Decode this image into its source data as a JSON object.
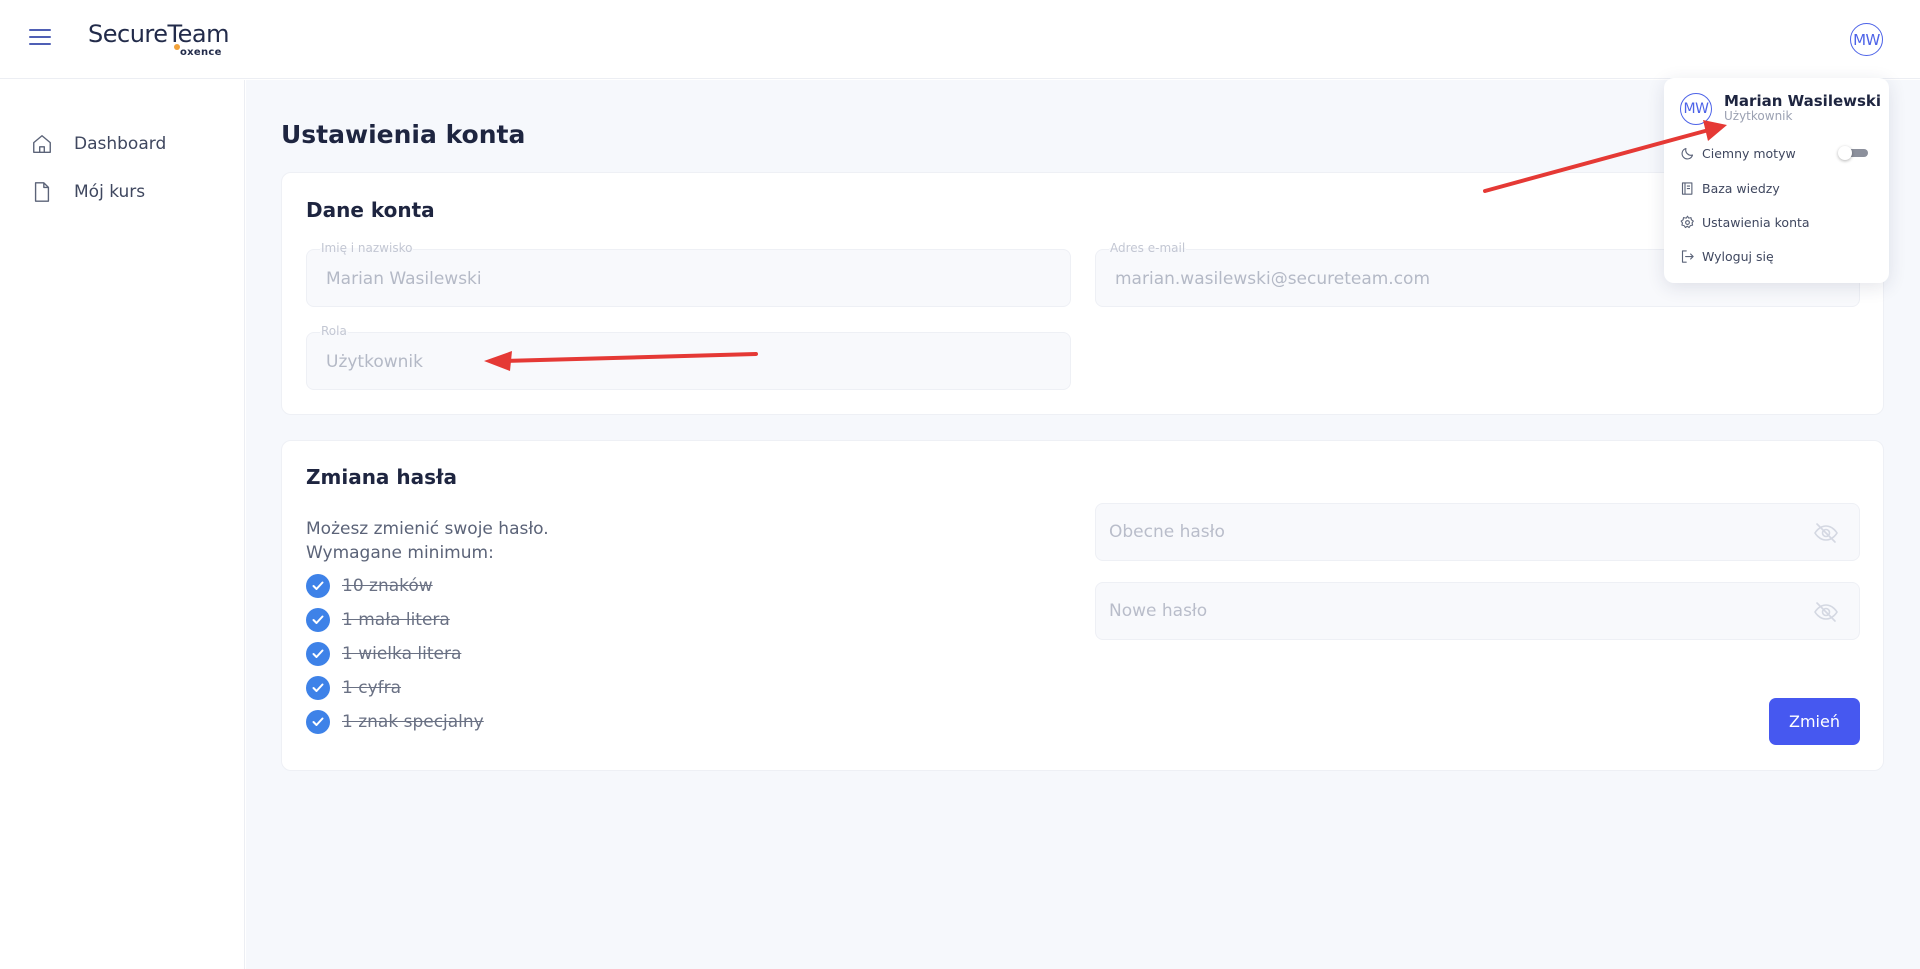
{
  "header": {
    "logo_main": "SecureTeam",
    "logo_sub": "oxence",
    "avatar_initials": "MW"
  },
  "sidebar": {
    "items": [
      {
        "label": "Dashboard",
        "icon": "home-icon"
      },
      {
        "label": "Mój kurs",
        "icon": "file-icon"
      }
    ]
  },
  "main": {
    "page_title": "Ustawienia konta",
    "account": {
      "title": "Dane konta",
      "name_label": "Imię i nazwisko",
      "name_value": "Marian Wasilewski",
      "email_label": "Adres e-mail",
      "email_value": "marian.wasilewski@secureteam.com",
      "role_label": "Rola",
      "role_value": "Użytkownik"
    },
    "password": {
      "title": "Zmiana hasła",
      "description": "Możesz zmienić swoje hasło. Wymagane minimum:",
      "requirements": [
        "10 znaków",
        "1 mała litera",
        "1 wielka litera",
        "1 cyfra",
        "1 znak specjalny"
      ],
      "current_placeholder": "Obecne hasło",
      "new_placeholder": "Nowe hasło",
      "submit_label": "Zmień"
    }
  },
  "user_menu": {
    "avatar_initials": "MW",
    "name": "Marian Wasilewski",
    "role": "Użytkownik",
    "items": [
      {
        "label": "Ciemny motyw",
        "icon": "moon-icon"
      },
      {
        "label": "Baza wiedzy",
        "icon": "book-icon"
      },
      {
        "label": "Ustawienia konta",
        "icon": "gear-icon"
      },
      {
        "label": "Wyloguj się",
        "icon": "logout-icon"
      }
    ],
    "dark_mode_enabled": false
  },
  "colors": {
    "accent": "#4658f0",
    "check": "#3e82e8",
    "annotation": "#e53935"
  }
}
